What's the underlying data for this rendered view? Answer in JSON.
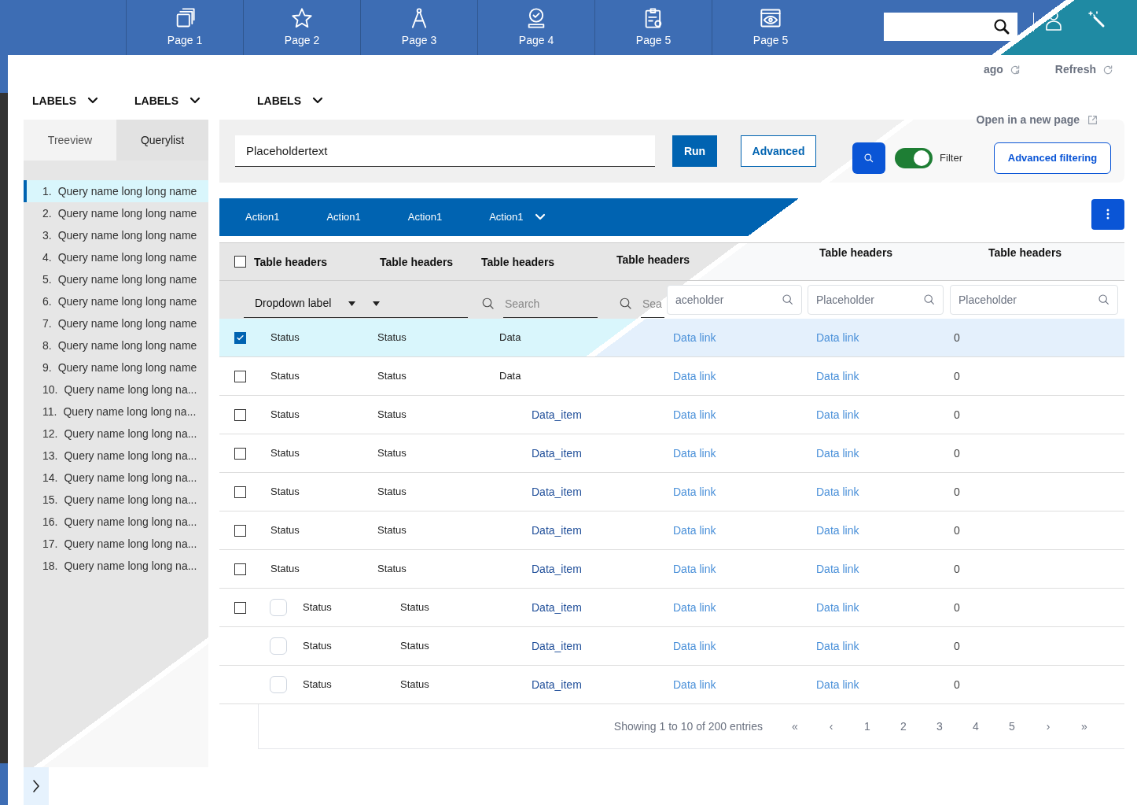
{
  "top_nav": {
    "items": [
      "Page 1",
      "Page 2",
      "Page 3",
      "Page 4",
      "Page 5",
      "Page 5"
    ]
  },
  "header_dropdowns": [
    "LABELS",
    "LABELS",
    "LABELS"
  ],
  "status_links": [
    "ago",
    "Refresh"
  ],
  "sidebar": {
    "tabs": [
      {
        "label": "Treeview",
        "selected": false
      },
      {
        "label": "Querylist",
        "selected": true
      }
    ],
    "items": [
      {
        "number": "1.",
        "label": "Query name long long name",
        "selected": true
      },
      {
        "number": "2.",
        "label": "Query name long long name",
        "selected": false
      },
      {
        "number": "3.",
        "label": "Query name long long name",
        "selected": false
      },
      {
        "number": "4.",
        "label": "Query name long long name",
        "selected": false
      },
      {
        "number": "5.",
        "label": "Query name long long name",
        "selected": false
      },
      {
        "number": "6.",
        "label": "Query name long long name",
        "selected": false
      },
      {
        "number": "7.",
        "label": "Query name long long name",
        "selected": false
      },
      {
        "number": "8.",
        "label": "Query name long long name",
        "selected": false
      },
      {
        "number": "9.",
        "label": "Query name long long name",
        "selected": false
      },
      {
        "number": "10.",
        "label": "Query name long long na...",
        "selected": false
      },
      {
        "number": "11.",
        "label": "Query name long long na...",
        "selected": false
      },
      {
        "number": "12.",
        "label": "Query name long long na...",
        "selected": false
      },
      {
        "number": "13.",
        "label": "Query name long long na...",
        "selected": false
      },
      {
        "number": "14.",
        "label": "Query name long long na...",
        "selected": false
      },
      {
        "number": "15.",
        "label": "Query name long long na...",
        "selected": false
      },
      {
        "number": "16.",
        "label": "Query name long long na...",
        "selected": false
      },
      {
        "number": "17.",
        "label": "Query name long long na...",
        "selected": false
      },
      {
        "number": "18.",
        "label": "Query name long long na...",
        "selected": false
      }
    ]
  },
  "query_bar": {
    "value": "Placeholdertext",
    "buttons": [
      "Run",
      "Advanced"
    ],
    "open_link": "Open in a new page",
    "filter": {
      "label": "Filter",
      "on": true
    },
    "advanced_filtering": "Advanced filtering"
  },
  "action_bar": {
    "actions": [
      "Action1",
      "Action1",
      "Action1",
      "Action1"
    ]
  },
  "table": {
    "header_checked": false,
    "columns": [
      "Table headers",
      "Table headers",
      "Table headers",
      "Table headers",
      "Table headers",
      "Table headers"
    ],
    "filters": [
      {
        "kind": "dropdown",
        "label": "Dropdown label"
      },
      {
        "kind": "dropdown"
      },
      {
        "kind": "search",
        "placeholder": "Search"
      },
      {
        "kind": "search",
        "placeholder": "Sea"
      },
      {
        "kind": "field",
        "placeholder": "aceholder"
      },
      {
        "kind": "field",
        "placeholder": "Placeholder"
      },
      {
        "kind": "field",
        "placeholder": "Placeholder"
      }
    ],
    "rows": [
      {
        "kind": "old",
        "selected": true,
        "checked": true,
        "status_1": "Status",
        "status_2": "Status",
        "data": {
          "kind": "text",
          "text": "Data"
        },
        "link_1": "Data link",
        "link_2": "Data link",
        "count": "0"
      },
      {
        "kind": "old",
        "selected": false,
        "checked": false,
        "status_1": "Status",
        "status_2": "Status",
        "data": {
          "kind": "text",
          "text": "Data"
        },
        "link_1": "Data link",
        "link_2": "Data link",
        "count": "0"
      },
      {
        "kind": "old",
        "selected": false,
        "checked": false,
        "status_1": "Status",
        "status_2": "Status",
        "data": {
          "kind": "link",
          "text": "Data_item"
        },
        "link_1": "Data link",
        "link_2": "Data link",
        "count": "0"
      },
      {
        "kind": "old",
        "selected": false,
        "checked": false,
        "status_1": "Status",
        "status_2": "Status",
        "data": {
          "kind": "link",
          "text": "Data_item"
        },
        "link_1": "Data link",
        "link_2": "Data link",
        "count": "0"
      },
      {
        "kind": "old",
        "selected": false,
        "checked": false,
        "status_1": "Status",
        "status_2": "Status",
        "data": {
          "kind": "link",
          "text": "Data_item"
        },
        "link_1": "Data link",
        "link_2": "Data link",
        "count": "0"
      },
      {
        "kind": "old",
        "selected": false,
        "checked": false,
        "status_1": "Status",
        "status_2": "Status",
        "data": {
          "kind": "link",
          "text": "Data_item"
        },
        "link_1": "Data link",
        "link_2": "Data link",
        "count": "0"
      },
      {
        "kind": "old",
        "selected": false,
        "checked": false,
        "status_1": "Status",
        "status_2": "Status",
        "data": {
          "kind": "link",
          "text": "Data_item"
        },
        "link_1": "Data link",
        "link_2": "Data link",
        "count": "0"
      },
      {
        "kind": "mixed",
        "selected": false,
        "checked": false,
        "status_1": "Status",
        "status_2": "Status",
        "data": {
          "kind": "link",
          "text": "Data_item"
        },
        "link_1": "Data link",
        "link_2": "Data link",
        "count": "0"
      },
      {
        "kind": "new",
        "selected": false,
        "checked": false,
        "status_1": "Status",
        "status_2": "Status",
        "data": {
          "kind": "link",
          "text": "Data_item"
        },
        "link_1": "Data link",
        "link_2": "Data link",
        "count": "0"
      },
      {
        "kind": "new",
        "selected": false,
        "checked": false,
        "status_1": "Status",
        "status_2": "Status",
        "data": {
          "kind": "link",
          "text": "Data_item"
        },
        "link_1": "Data link",
        "link_2": "Data link",
        "count": "0"
      }
    ]
  },
  "pagination": {
    "summary": "Showing 1 to 10 of 200 entries",
    "pages": [
      "«",
      "‹",
      "1",
      "2",
      "3",
      "4",
      "5",
      "›",
      "»"
    ]
  }
}
